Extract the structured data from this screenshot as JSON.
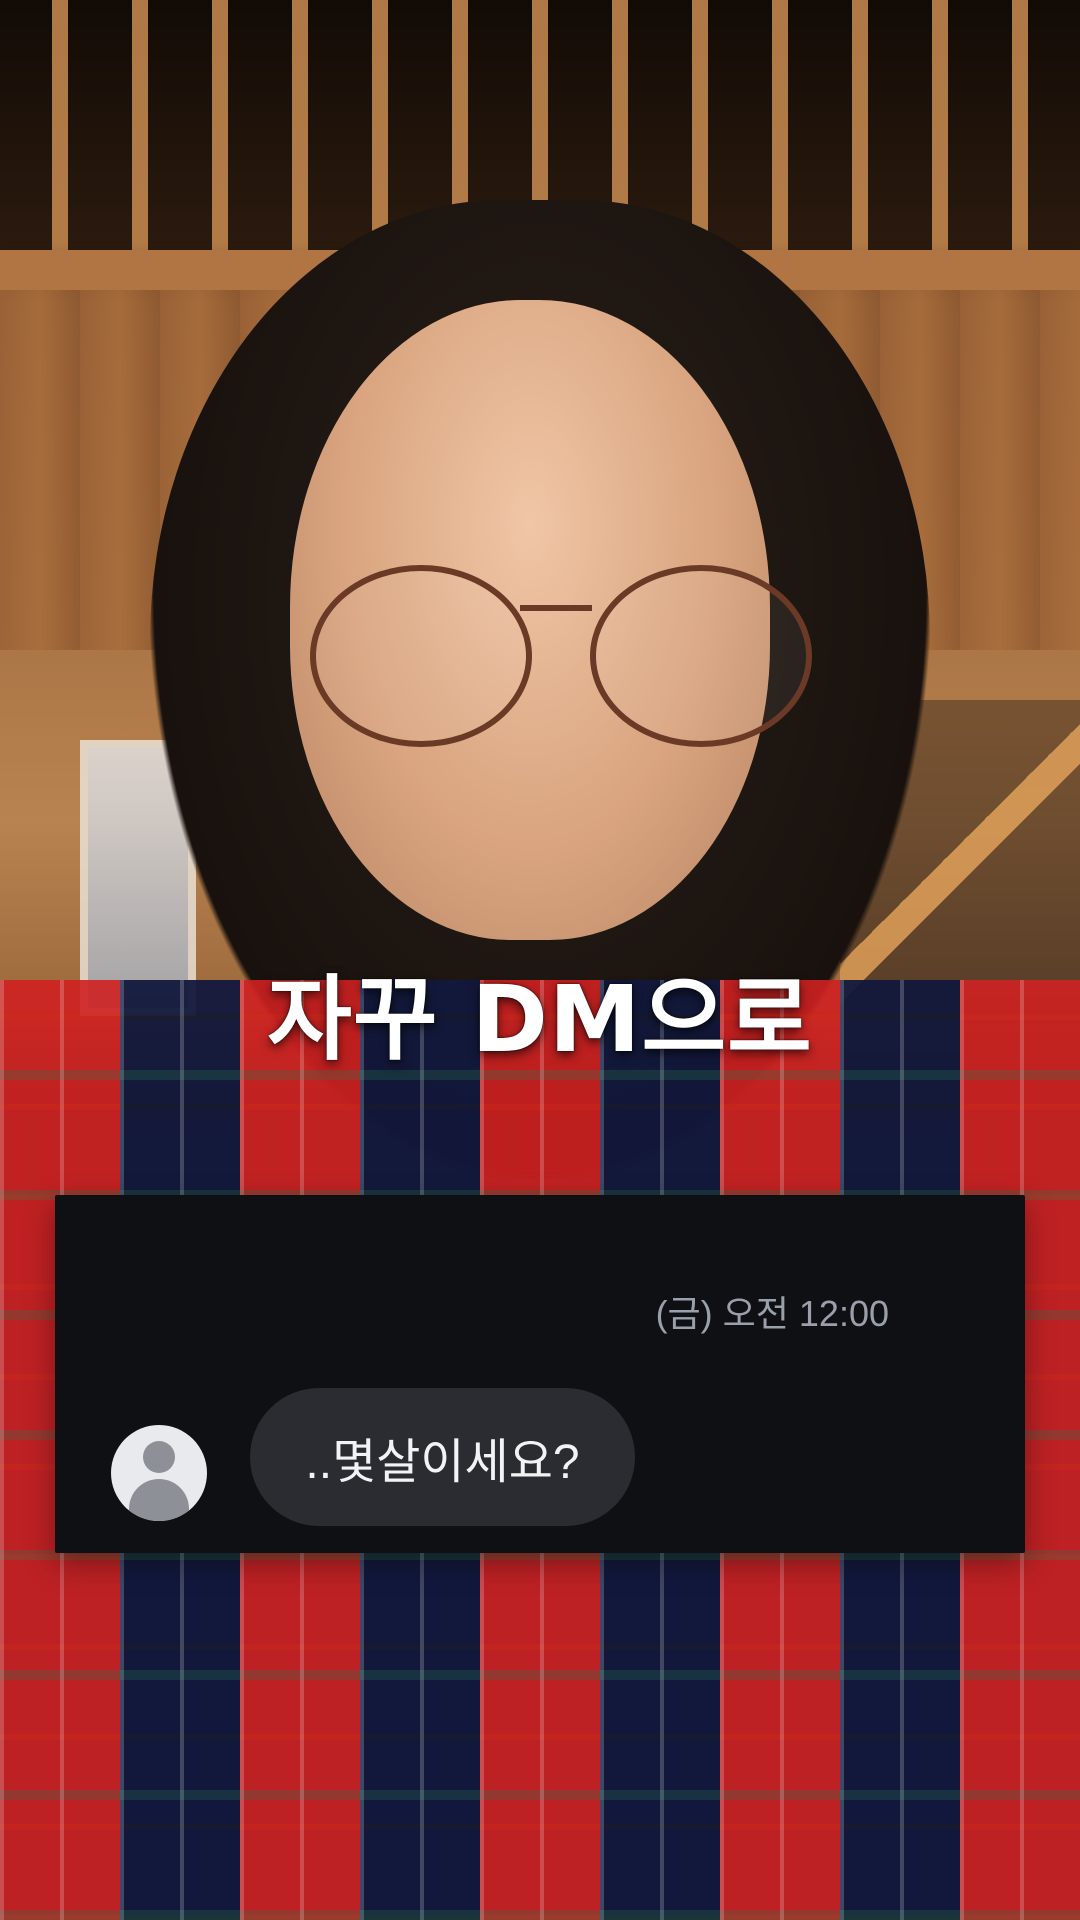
{
  "caption": {
    "text": "자꾸 DM으로"
  },
  "dm": {
    "timestamp": "(금) 오전 12:00",
    "message": "..몇살이세요?",
    "avatar_icon": "user-avatar-icon"
  },
  "colors": {
    "panel_bg": "#0f1014",
    "bubble_bg": "#2a2c32",
    "time_text": "#9aa0ab",
    "caption_text": "#ffffff"
  }
}
